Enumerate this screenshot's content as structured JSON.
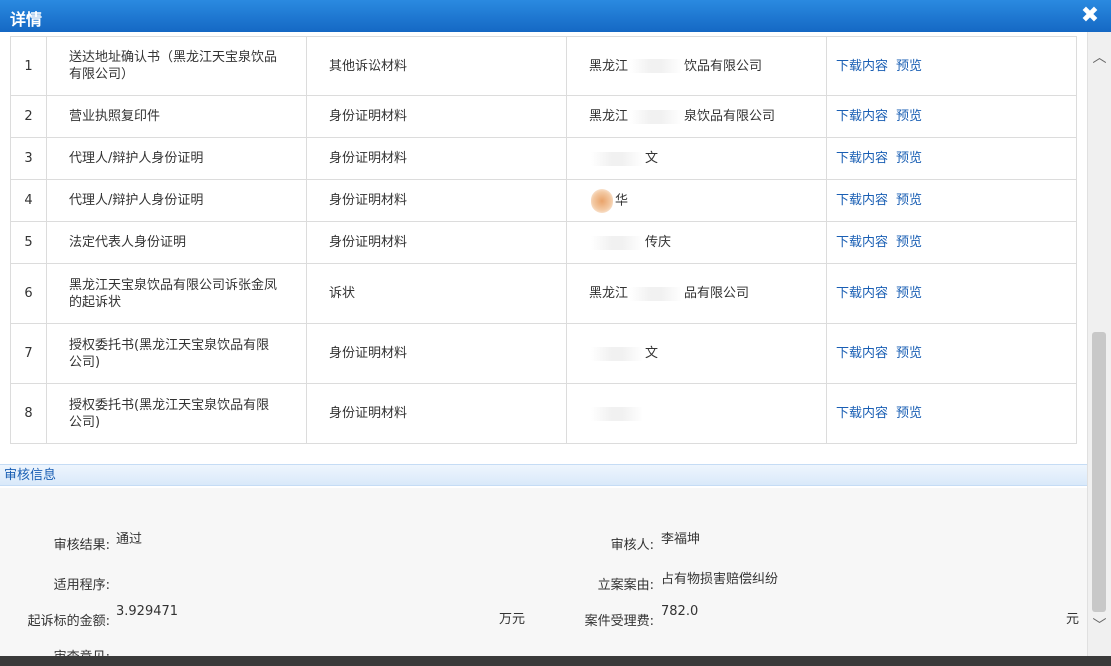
{
  "window": {
    "title": "详情",
    "close_glyph": "✖"
  },
  "files": [
    {
      "index": "1",
      "name": "送达地址确认书（黑龙江天宝泉饮品有限公司）",
      "category": "其他诉讼材料",
      "submitter_a": "黑龙江",
      "submitter_b": "饮品有限公司"
    },
    {
      "index": "2",
      "name": "营业执照复印件",
      "category": "身份证明材料",
      "submitter_a": "黑龙江",
      "submitter_b": "泉饮品有限公司"
    },
    {
      "index": "3",
      "name": "代理人/辩护人身份证明",
      "category": "身份证明材料",
      "submitter_a": "",
      "submitter_b": "文"
    },
    {
      "index": "4",
      "name": "代理人/辩护人身份证明",
      "category": "身份证明材料",
      "submitter_a": "",
      "submitter_b": "华"
    },
    {
      "index": "5",
      "name": "法定代表人身份证明",
      "category": "身份证明材料",
      "submitter_a": "",
      "submitter_b": "传庆"
    },
    {
      "index": "6",
      "name": "黑龙江天宝泉饮品有限公司诉张金凤的起诉状",
      "category": "诉状",
      "submitter_a": "黑龙江",
      "submitter_b": "品有限公司"
    },
    {
      "index": "7",
      "name": "授权委托书(黑龙江天宝泉饮品有限公司)",
      "category": "身份证明材料",
      "submitter_a": "",
      "submitter_b": "文"
    },
    {
      "index": "8",
      "name": "授权委托书(黑龙江天宝泉饮品有限公司)",
      "category": "身份证明材料",
      "submitter_a": "",
      "submitter_b": ""
    }
  ],
  "actions": {
    "download": "下载内容",
    "preview": "预览"
  },
  "review": {
    "section_title": "审核信息",
    "result_label": "审核结果:",
    "result_value": "通过",
    "reviewer_label": "审核人:",
    "reviewer_value": "李福坤",
    "procedure_label": "适用程序:",
    "procedure_value": "",
    "cause_label": "立案案由:",
    "cause_value": "占有物损害赔偿纠纷",
    "amount_label": "起诉标的金额:",
    "amount_value": "3.929471",
    "amount_unit": "万元",
    "fee_label": "案件受理费:",
    "fee_value": "782.0",
    "fee_unit": "元",
    "opinion_label": "审查意见:",
    "opinion_value": ""
  }
}
